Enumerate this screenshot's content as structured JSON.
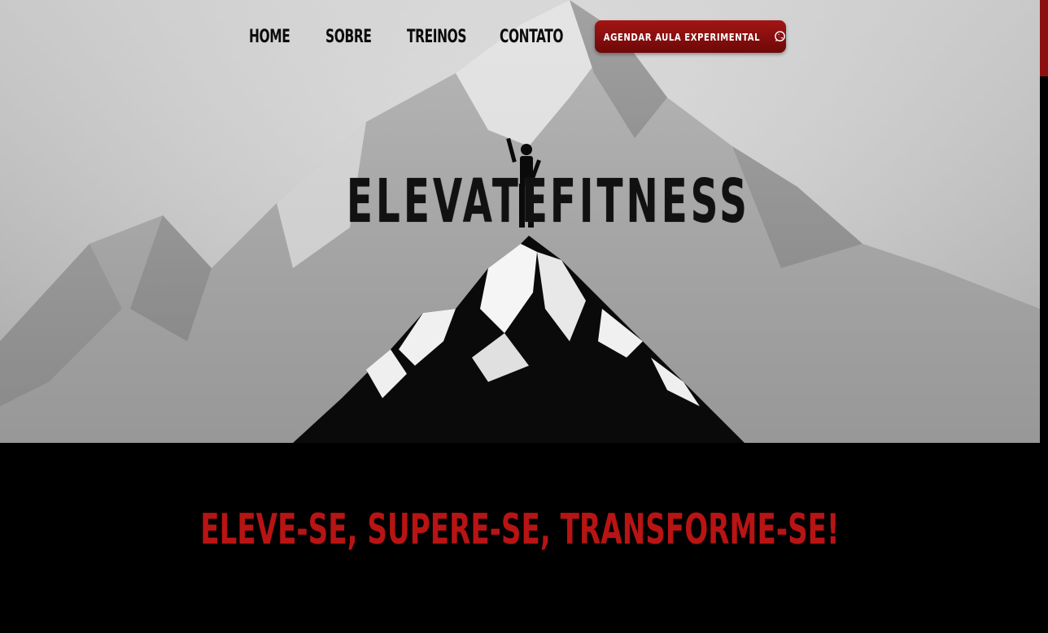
{
  "nav": {
    "items": [
      {
        "label": "HOME"
      },
      {
        "label": "SOBRE"
      },
      {
        "label": "TREINOS"
      },
      {
        "label": "CONTATO"
      }
    ],
    "cta_label": "AGENDAR AULA EXPERIMENTAL",
    "cta_icon": "whatsapp-icon"
  },
  "brand": {
    "word1": "ELEVATE",
    "word2": "FITNESS"
  },
  "tagline": "ELEVE-SE, SUPERE-SE, TRANSFORME-SE!",
  "colors": {
    "accent": "#b81414",
    "button_top": "#a31515",
    "button_bottom": "#6e0808",
    "background": "#000000"
  }
}
